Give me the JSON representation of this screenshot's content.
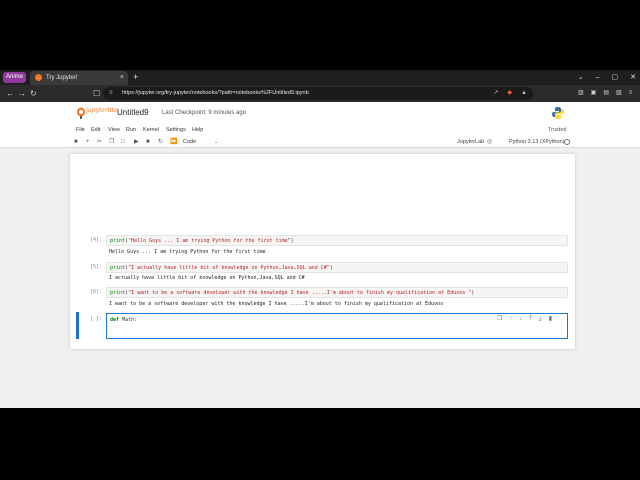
{
  "browser": {
    "profile_label": "Anime",
    "tab_title": "Try Jupyter!",
    "tab_close": "×",
    "new_tab": "+",
    "window_controls": [
      "⌄",
      "–",
      "▢",
      "✕"
    ],
    "url": "https://jupyter.org/try-jupyter/notebooks/?path=notebooks%2FUntitled9.ipynb"
  },
  "jupyter": {
    "logo_text": "jupyterlite",
    "notebook_name": "Untitled9",
    "checkpoint": "Last Checkpoint: 9 minutes ago",
    "menu": [
      "File",
      "Edit",
      "View",
      "Run",
      "Kernel",
      "Settings",
      "Help"
    ],
    "trusted": "Trusted",
    "cell_type": "Code",
    "jupyterlab_link": "JupyterLab",
    "kernel": "Python 3.13 (XPython)"
  },
  "cells": [
    {
      "prompt": "[4]:",
      "fn": "print",
      "arg": "\"Hello Guys ... I am trying Python for the first time\"",
      "output": "Hello Guys ... I am trying Python for the first time"
    },
    {
      "prompt": "[5]:",
      "fn": "print",
      "arg": "\"I actually have little bit of knowledge on Python,Java,SQL and C#\"",
      "output": "I actually have little bit of knowledge on Python,Java,SQL and C#"
    },
    {
      "prompt": "[6]:",
      "fn": "print",
      "arg": "\"I want to be a software developer with the knowledge I have .....I'm about to finish my qualification at Eduvos \"",
      "output": "I want to be a software developer with the knowledge I have .....I'm about to finish my qualification at Eduvos"
    }
  ],
  "active_cell": {
    "prompt": "[ ]:",
    "keyword": "def",
    "rest": " Math:"
  },
  "colors": {
    "accent": "#1976d2",
    "jupyter_orange": "#f37726",
    "profile": "#8e3a9a"
  }
}
